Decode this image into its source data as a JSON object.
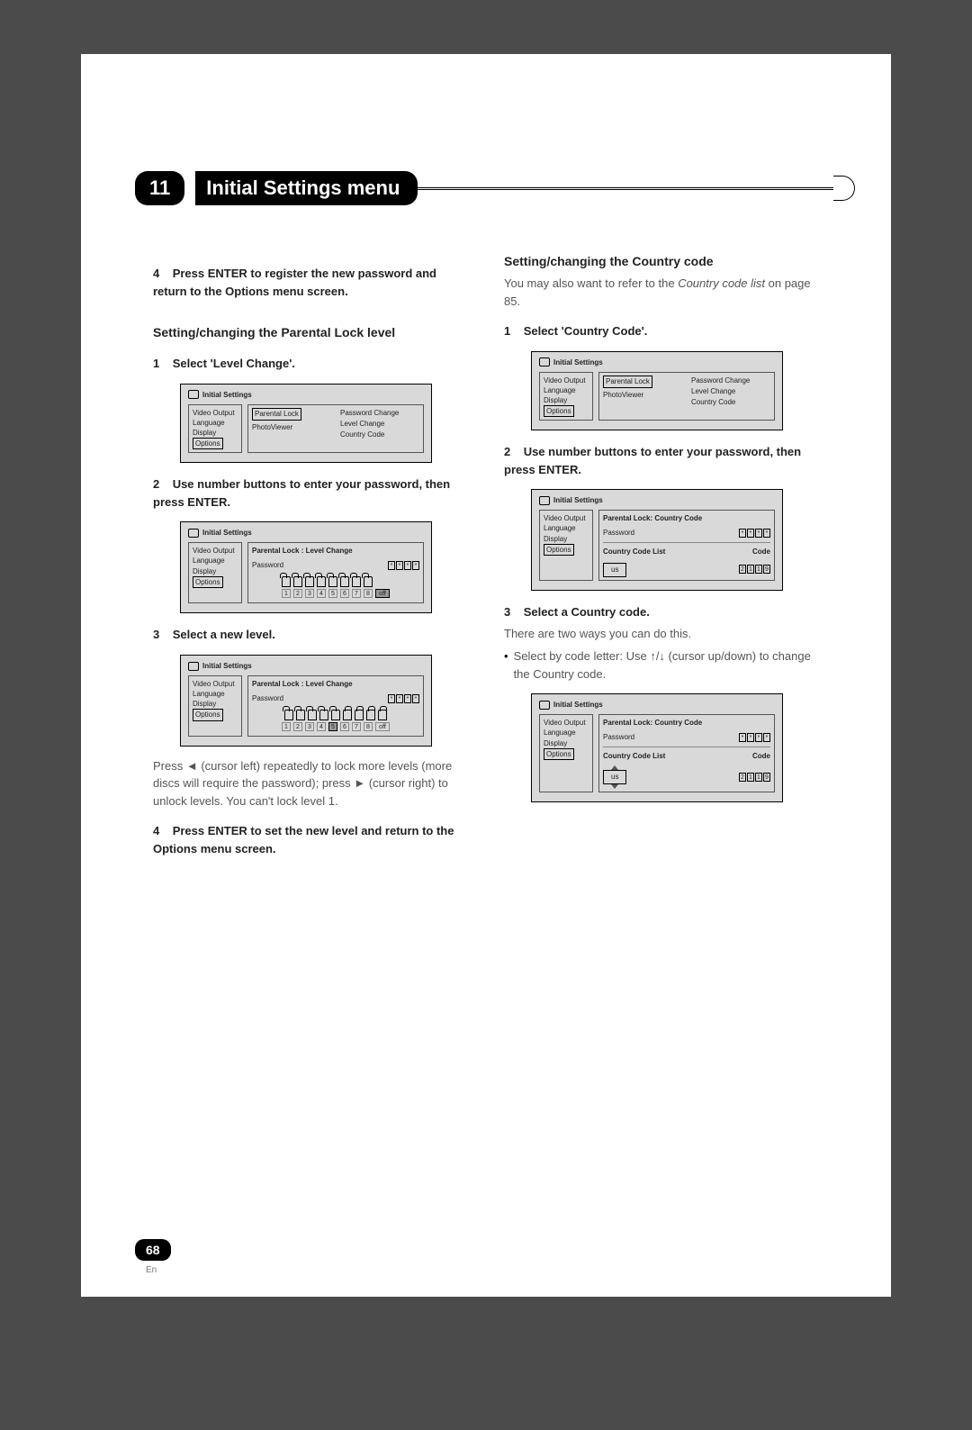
{
  "chapter": {
    "number": "11",
    "title": "Initial Settings menu"
  },
  "left": {
    "step4": {
      "num": "4",
      "title": "Press ENTER to register the new password and return to the Options menu screen."
    },
    "sectionA": "Setting/changing the Parental Lock level",
    "step1": {
      "num": "1",
      "title": "Select 'Level Change'."
    },
    "screen1": {
      "header": "Initial Settings",
      "sidebar": [
        "Video Output",
        "Language",
        "Display",
        "Options"
      ],
      "sidebar_selected": "Options",
      "pane": [
        "Parental Lock",
        "PhotoViewer"
      ],
      "pane_selected": "Parental Lock",
      "submenu": [
        "Password Change",
        "Level Change",
        "Country Code"
      ]
    },
    "step2": {
      "num": "2",
      "title": "Use number buttons to enter your password, then press ENTER."
    },
    "screen2": {
      "header": "Initial Settings",
      "sidebar": [
        "Video Output",
        "Language",
        "Display",
        "Options"
      ],
      "sidebar_selected": "Options",
      "panel_title": "Parental Lock : Level Change",
      "password_label": "Password",
      "password": [
        "*",
        "*",
        "*",
        "*"
      ],
      "levels": [
        "1",
        "2",
        "3",
        "4",
        "5",
        "6",
        "7",
        "8",
        "off"
      ],
      "locks_open_from": 9
    },
    "step3": {
      "num": "3",
      "title": "Select a new level."
    },
    "screen3": {
      "header": "Initial Settings",
      "sidebar": [
        "Video Output",
        "Language",
        "Display",
        "Options"
      ],
      "sidebar_selected": "Options",
      "panel_title": "Parental Lock : Level Change",
      "password_label": "Password",
      "password": [
        "*",
        "*",
        "*",
        "*"
      ],
      "levels": [
        "1",
        "2",
        "3",
        "4",
        "5",
        "6",
        "7",
        "8",
        "off"
      ],
      "selected_level_index": 4,
      "locks_open_from": 5
    },
    "para1a": "Press ",
    "para1_icon_left": "◄",
    "para1b": " (cursor left) repeatedly to lock more levels (more discs will require the password); press ",
    "para1_icon_right": "►",
    "para1c": " (cursor right) to unlock levels. You can't lock level 1.",
    "step4b": {
      "num": "4",
      "title": "Press ENTER to set the new level and return to the Options menu screen."
    }
  },
  "right": {
    "sectionB": "Setting/changing the Country code",
    "bodyB1": "You may also want to refer to the ",
    "bodyB_italic": "Country code list",
    "bodyB2": " on page 85.",
    "step1": {
      "num": "1",
      "title": "Select 'Country Code'."
    },
    "screen1": {
      "header": "Initial Settings",
      "sidebar": [
        "Video Output",
        "Language",
        "Display",
        "Options"
      ],
      "sidebar_selected": "Options",
      "pane": [
        "Parental Lock",
        "PhotoViewer"
      ],
      "pane_selected": "Parental Lock",
      "submenu": [
        "Password Change",
        "Level Change",
        "Country Code"
      ]
    },
    "step2": {
      "num": "2",
      "title": "Use number buttons to enter your password, then press ENTER."
    },
    "screen2": {
      "header": "Initial Settings",
      "sidebar": [
        "Video Output",
        "Language",
        "Display",
        "Options"
      ],
      "sidebar_selected": "Options",
      "panel_title": "Parental Lock: Country Code",
      "password_label": "Password",
      "password": [
        "*",
        "*",
        "*",
        "*"
      ],
      "list_label": "Country Code List",
      "code_label": "Code",
      "country": "us",
      "code": [
        "2",
        "1",
        "1",
        "9"
      ]
    },
    "step3": {
      "num": "3",
      "title": "Select a Country code."
    },
    "body3": "There are two ways you can do this.",
    "bullet_a": "Select by code letter: Use ",
    "bullet_icons": "↑/↓",
    "bullet_b": " (cursor up/down) to change the Country code.",
    "screen3": {
      "header": "Initial Settings",
      "sidebar": [
        "Video Output",
        "Language",
        "Display",
        "Options"
      ],
      "sidebar_selected": "Options",
      "panel_title": "Parental Lock: Country Code",
      "password_label": "Password",
      "password": [
        "*",
        "*",
        "*",
        "*"
      ],
      "list_label": "Country Code List",
      "code_label": "Code",
      "country": "us",
      "code": [
        "2",
        "1",
        "1",
        "9"
      ]
    }
  },
  "pagenum": "68",
  "pagelang": "En"
}
